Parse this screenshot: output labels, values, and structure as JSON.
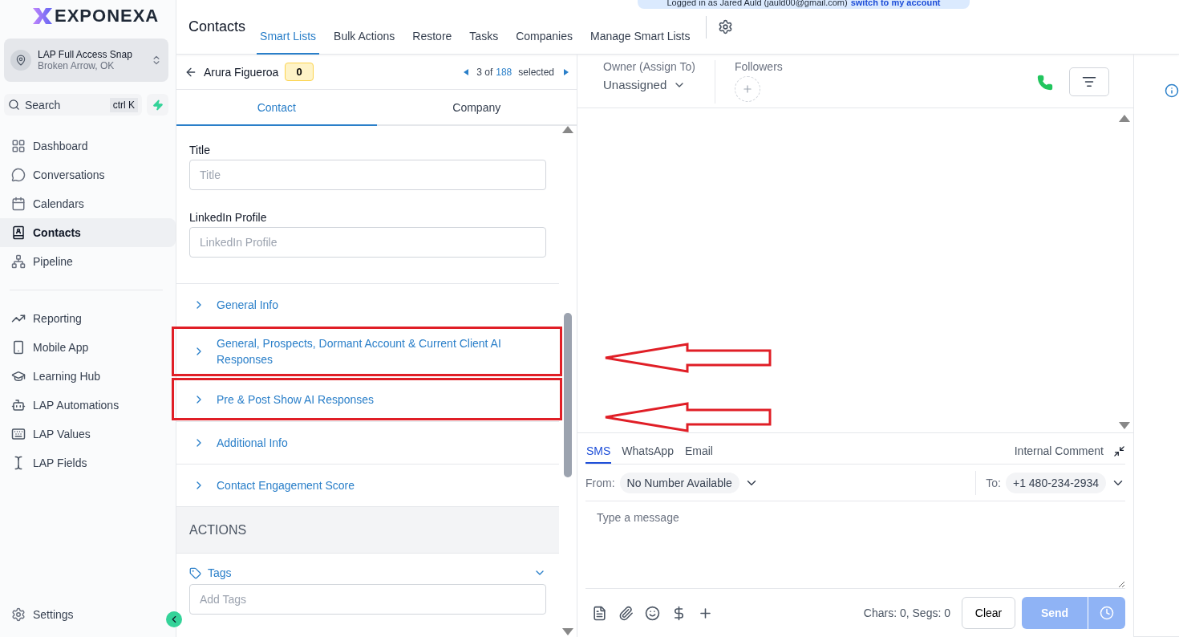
{
  "banner": {
    "text": "Logged in as Jared Auld (jauld00@gmail.com)",
    "link": "switch to my account"
  },
  "brand": {
    "name": "EXPONEXA"
  },
  "account": {
    "name": "LAP Full Access Snap",
    "location": "Broken Arrow, OK"
  },
  "search": {
    "placeholder": "Search",
    "shortcut": "ctrl K"
  },
  "sidebar": {
    "items": [
      {
        "label": "Dashboard",
        "selected": false
      },
      {
        "label": "Conversations",
        "selected": false
      },
      {
        "label": "Calendars",
        "selected": false
      },
      {
        "label": "Contacts",
        "selected": true
      },
      {
        "label": "Pipeline",
        "selected": false
      }
    ],
    "items_2": [
      {
        "label": "Reporting"
      },
      {
        "label": "Mobile App"
      },
      {
        "label": "Learning Hub"
      },
      {
        "label": "LAP Automations"
      },
      {
        "label": "LAP Values"
      },
      {
        "label": "LAP Fields"
      }
    ],
    "settings": "Settings"
  },
  "page_title": "Contacts",
  "tabs": [
    {
      "label": "Smart Lists",
      "selected": true
    },
    {
      "label": "Bulk Actions",
      "selected": false
    },
    {
      "label": "Restore",
      "selected": false
    },
    {
      "label": "Tasks",
      "selected": false
    },
    {
      "label": "Companies",
      "selected": false
    },
    {
      "label": "Manage Smart Lists",
      "selected": false
    }
  ],
  "contact": {
    "name": "Arura Figueroa",
    "badge": "0",
    "position": "3 of",
    "total": "188",
    "selected_label": "selected"
  },
  "detail_tabs": [
    {
      "label": "Contact",
      "selected": true
    },
    {
      "label": "Company",
      "selected": false
    }
  ],
  "fields": [
    {
      "label": "Title",
      "placeholder": "Title"
    },
    {
      "label": "LinkedIn Profile",
      "placeholder": "LinkedIn Profile"
    }
  ],
  "sections": [
    {
      "label": "General Info",
      "highlighted": false
    },
    {
      "label": "General, Prospects, Dormant Account & Current Client AI Responses",
      "highlighted": true
    },
    {
      "label": "Pre & Post Show AI Responses",
      "highlighted": true
    },
    {
      "label": "Additional Info",
      "highlighted": false
    },
    {
      "label": "Contact Engagement Score",
      "highlighted": false
    }
  ],
  "actions": {
    "heading": "ACTIONS",
    "tags_label": "Tags",
    "tags_placeholder": "Add Tags"
  },
  "owner": {
    "label": "Owner (Assign To)",
    "value": "Unassigned"
  },
  "followers": {
    "label": "Followers"
  },
  "composer": {
    "channels": [
      {
        "label": "SMS",
        "selected": true
      },
      {
        "label": "WhatsApp",
        "selected": false
      },
      {
        "label": "Email",
        "selected": false
      }
    ],
    "internal": "Internal Comment",
    "from_label": "From:",
    "from_value": "No Number Available",
    "to_label": "To:",
    "to_value": "+1 480-234-2934",
    "placeholder": "Type a message",
    "counter": "Chars: 0, Segs: 0",
    "clear": "Clear",
    "send": "Send"
  }
}
